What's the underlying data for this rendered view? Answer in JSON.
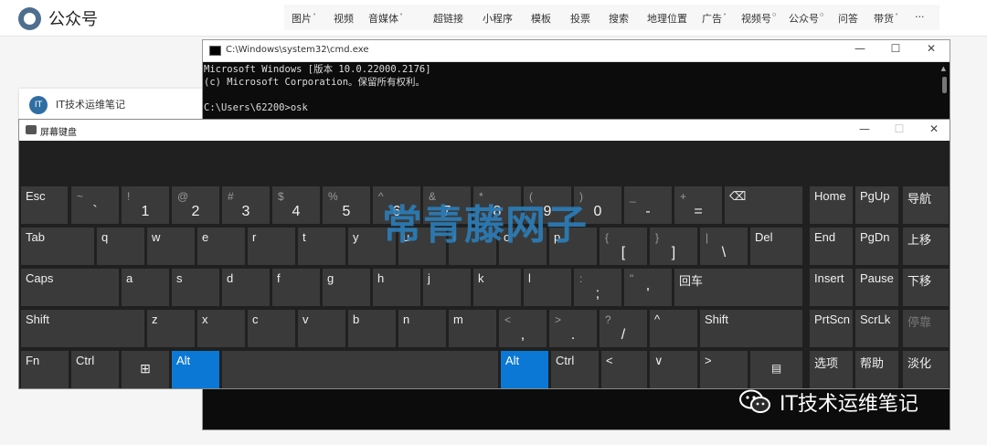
{
  "editor": {
    "logo_text": "公众号",
    "toolbar": [
      {
        "label": "图片",
        "dot": "•"
      },
      {
        "label": "视频"
      },
      {
        "label": "音媒体",
        "dot": "•"
      },
      {
        "label": "超链接"
      },
      {
        "label": "小程序"
      },
      {
        "label": "模板"
      },
      {
        "label": "投票"
      },
      {
        "label": "搜索"
      },
      {
        "label": "地理位置"
      },
      {
        "label": "广告",
        "dot": "•"
      },
      {
        "label": "视频号",
        "dot": "o"
      },
      {
        "label": "公众号",
        "dot": "o"
      },
      {
        "label": "问答"
      },
      {
        "label": "带货",
        "dot": "•"
      },
      {
        "label": "···"
      }
    ]
  },
  "background_card": {
    "icon": "IT",
    "text": "IT技术运维笔记"
  },
  "cmd": {
    "title": "C:\\Windows\\system32\\cmd.exe",
    "minimize": "—",
    "maximize": "☐",
    "close": "✕",
    "lines": [
      "Microsoft Windows [版本 10.0.22000.2176]",
      "(c) Microsoft Corporation。保留所有权利。",
      "",
      "C:\\Users\\62200>osk"
    ]
  },
  "osk": {
    "title": "屏幕键盘",
    "minimize": "—",
    "maximize": "☐",
    "close": "✕",
    "keys": {
      "esc": "Esc",
      "tilde_top": "~",
      "tilde_main": "`",
      "n1_top": "!",
      "n1_main": "1",
      "n2_top": "@",
      "n2_main": "2",
      "n3_top": "#",
      "n3_main": "3",
      "n4_top": "$",
      "n4_main": "4",
      "n5_top": "%",
      "n5_main": "5",
      "n6_top": "^",
      "n6_main": "6",
      "n7_top": "&",
      "n7_main": "7",
      "n8_top": "*",
      "n8_main": "8",
      "n9_top": "(",
      "n9_main": "9",
      "n0_top": ")",
      "n0_main": "0",
      "minus_top": "_",
      "minus_main": "-",
      "equal_top": "+",
      "equal_main": "=",
      "backspace": "⌫",
      "tab": "Tab",
      "q": "q",
      "w": "w",
      "e": "e",
      "r": "r",
      "t": "t",
      "y": "y",
      "u": "u",
      "i": "i",
      "o": "o",
      "p": "p",
      "lbracket_top": "{",
      "lbracket_main": "[",
      "rbracket_top": "}",
      "rbracket_main": "]",
      "backslash_top": "|",
      "backslash_main": "\\",
      "del": "Del",
      "caps": "Caps",
      "a": "a",
      "s": "s",
      "d": "d",
      "f": "f",
      "g": "g",
      "h": "h",
      "j": "j",
      "k": "k",
      "l": "l",
      "semicolon_top": ":",
      "semicolon_main": ";",
      "quote_top": "\"",
      "quote_main": "'",
      "enter": "回车",
      "shift_left": "Shift",
      "z": "z",
      "x": "x",
      "c": "c",
      "v": "v",
      "b": "b",
      "n": "n",
      "m": "m",
      "comma_top": "<",
      "comma_main": ",",
      "period_top": ">",
      "period_main": ".",
      "slash_top": "?",
      "slash_main": "/",
      "up": "^",
      "shift_right": "Shift",
      "fn": "Fn",
      "ctrl_left": "Ctrl",
      "win": "⊞",
      "alt_left": "Alt",
      "alt_right": "Alt",
      "ctrl_right": "Ctrl",
      "left": "<",
      "down": "∨",
      "right": ">",
      "menu": "▤",
      "home": "Home",
      "pgup": "PgUp",
      "nav": "导航",
      "end": "End",
      "pgdn": "PgDn",
      "move_up": "上移",
      "insert": "Insert",
      "pause": "Pause",
      "move_down": "下移",
      "prtscn": "PrtScn",
      "scrlk": "ScrLk",
      "dock": "停靠",
      "options": "选项",
      "help": "帮助",
      "fade": "淡化"
    }
  },
  "watermark": "常青藤网子",
  "brand": {
    "text": "IT技术运维笔记",
    "icon": "wechat-icon"
  }
}
